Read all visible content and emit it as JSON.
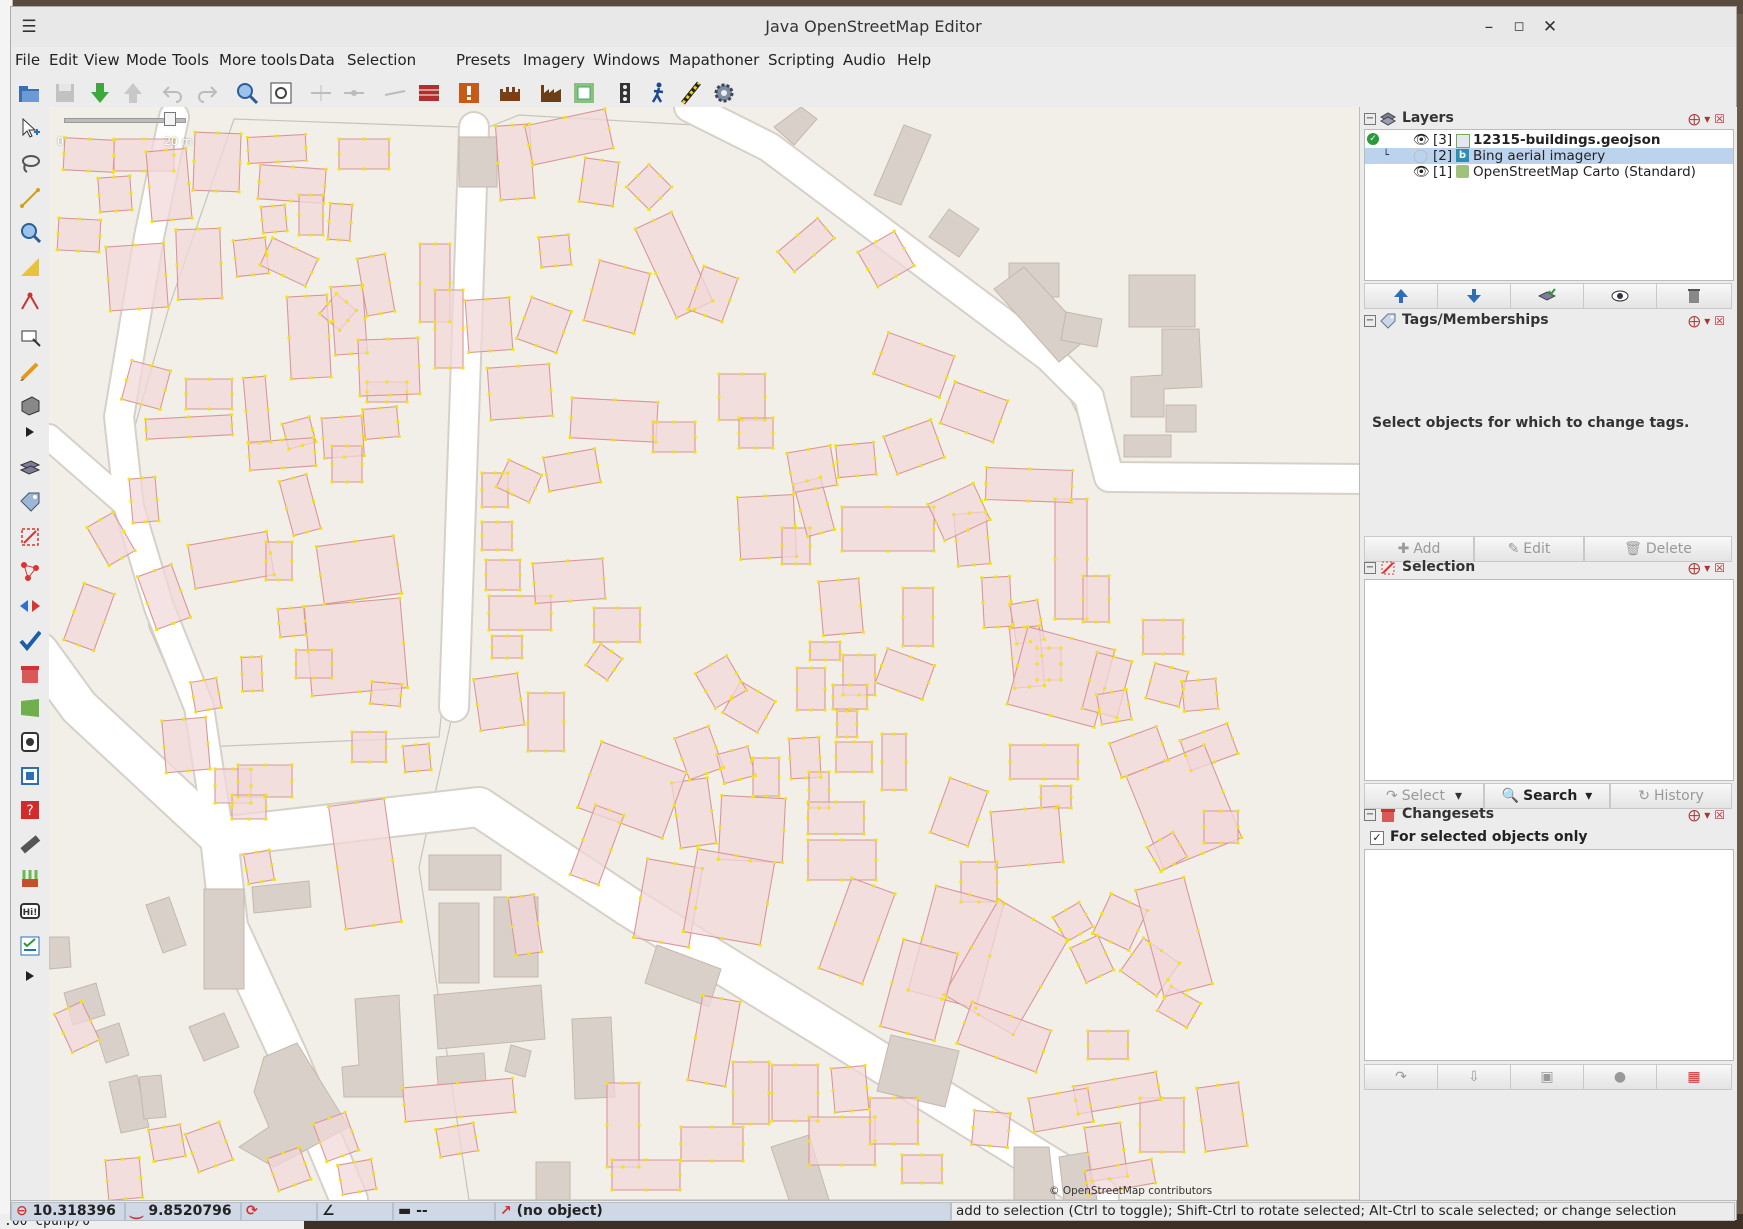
{
  "window": {
    "title": "Java OpenStreetMap Editor",
    "menu_icon": "hamburger-menu-icon",
    "controls": [
      "minimize-icon",
      "maximize-icon",
      "close-icon"
    ]
  },
  "menu": {
    "items": [
      {
        "label": "File",
        "u": "F"
      },
      {
        "label": "Edit",
        "u": "E"
      },
      {
        "label": "View",
        "u": "V"
      },
      {
        "label": "Mode",
        "u": "M"
      },
      {
        "label": "Tools",
        "u": "T"
      },
      {
        "label": "More tools",
        "u": "M"
      },
      {
        "label": "Data",
        "u": "D"
      },
      {
        "label": "Selection",
        "u": "S"
      },
      {
        "label": "Presets",
        "u": "P"
      },
      {
        "label": "Imagery",
        "u": "I"
      },
      {
        "label": "Windows",
        "u": "W"
      },
      {
        "label": "Mapathoner",
        "u": "M"
      },
      {
        "label": "Scripting",
        "u": "S"
      },
      {
        "label": "Audio",
        "u": "A"
      },
      {
        "label": "Help",
        "u": "H"
      }
    ]
  },
  "toolbar": {
    "buttons": [
      {
        "name": "open-file-icon",
        "enabled": true
      },
      {
        "name": "save-icon",
        "enabled": false
      },
      {
        "name": "download-icon",
        "enabled": true
      },
      {
        "name": "upload-icon",
        "enabled": false
      },
      {
        "name": "undo-icon",
        "enabled": false
      },
      {
        "name": "redo-icon",
        "enabled": false
      },
      {
        "name": "zoom-icon",
        "enabled": true
      },
      {
        "name": "preferences-icon",
        "enabled": true
      },
      {
        "name": "split-way-icon",
        "enabled": false
      },
      {
        "name": "combine-way-icon",
        "enabled": false
      },
      {
        "name": "unglue-icon",
        "enabled": false
      },
      {
        "name": "building-wall-icon",
        "enabled": true
      },
      {
        "name": "validation-warning-icon",
        "enabled": true
      },
      {
        "name": "castle-icon",
        "enabled": true
      },
      {
        "name": "industrial-icon",
        "enabled": true
      },
      {
        "name": "mapathoner-icon",
        "enabled": true
      },
      {
        "name": "traffic-signals-icon",
        "enabled": true
      },
      {
        "name": "pedestrian-icon",
        "enabled": true
      },
      {
        "name": "railway-crossing-icon",
        "enabled": true
      },
      {
        "name": "settings-gear-icon",
        "enabled": true
      }
    ]
  },
  "left_tools": [
    "select-mode-icon",
    "lasso-select-icon",
    "draw-way-icon",
    "zoom-mode-icon",
    "measure-angle-icon",
    "improve-way-icon",
    "parallel-way-icon",
    "draw-building-icon",
    "building-block-icon",
    "expand-tools-icon",
    "layers-toggle-icon",
    "tags-toggle-icon",
    "selection-toggle-icon",
    "relations-toggle-icon",
    "conflict-icon",
    "validator-check-icon",
    "filter-icon",
    "map-paint-icon",
    "mapillary-icon",
    "tag-checker-icon",
    "help-icon",
    "measurement-icon",
    "fuel-icon",
    "hi-icon",
    "task-list-icon",
    "expand-more-icon"
  ],
  "map": {
    "scale_labels": [
      "0",
      "20 m"
    ],
    "attribution": "© OpenStreetMap contributors"
  },
  "layers": {
    "title": "Layers",
    "items": [
      {
        "index": "[3]",
        "name": "12315-buildings.geojson",
        "visible": true,
        "active": true,
        "selected": false
      },
      {
        "index": "[2]",
        "name": "Bing aerial imagery",
        "visible": false,
        "active": false,
        "selected": true
      },
      {
        "index": "[1]",
        "name": "OpenStreetMap Carto (Standard)",
        "visible": true,
        "active": false,
        "selected": false
      }
    ],
    "buttons": [
      "move-up-icon",
      "move-down-icon",
      "merge-layer-icon",
      "show-layer-icon",
      "delete-layer-icon"
    ]
  },
  "tags": {
    "title": "Tags/Memberships",
    "empty_message": "Select objects for which to change tags.",
    "add_label": "Add",
    "edit_label": "Edit",
    "delete_label": "Delete"
  },
  "selection": {
    "title": "Selection",
    "select_label": "Select",
    "search_label": "Search",
    "history_label": "History"
  },
  "changesets": {
    "title": "Changesets",
    "checkbox_label": "For selected objects only",
    "checked": true
  },
  "status": {
    "lat": "10.318396",
    "lon": "9.8520796",
    "distance": "--",
    "object": "(no object)",
    "message": "add to selection (Ctrl to toggle); Shift-Ctrl to rotate selected; Alt-Ctrl to scale selected; or change selection"
  },
  "desktop": {
    "terminal_text": ".00 cpuhp/0"
  },
  "colors": {
    "building_fill": "#f1d8d8",
    "building_stroke": "#d89898",
    "node": "#f3e214",
    "osm_building": "#d9d0c9",
    "road": "#ffffff",
    "landuse": "#f2efe9",
    "selected_layer": "#bcd3ee"
  }
}
